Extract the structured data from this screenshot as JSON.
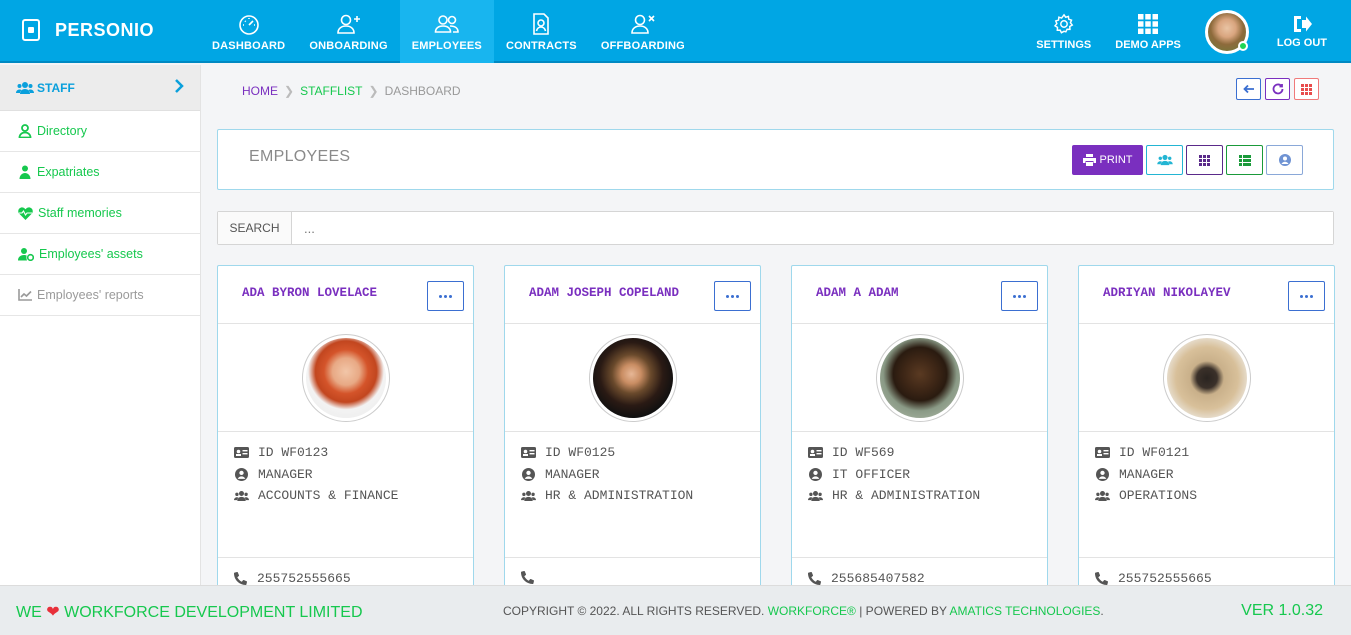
{
  "brand": {
    "name": "PERSONIO"
  },
  "nav": {
    "items": [
      {
        "label": "DASHBOARD"
      },
      {
        "label": "ONBOARDING"
      },
      {
        "label": "EMPLOYEES"
      },
      {
        "label": "CONTRACTS"
      },
      {
        "label": "OFFBOARDING"
      }
    ],
    "active": "EMPLOYEES"
  },
  "right_nav": {
    "settings": "SETTINGS",
    "demo_apps": "DEMO APPS",
    "logout": "LOG OUT"
  },
  "sidebar": {
    "header": "STAFF",
    "items": [
      {
        "label": "Directory",
        "icon": "user-tie-icon"
      },
      {
        "label": "Expatriates",
        "icon": "expat-icon"
      },
      {
        "label": "Staff memories",
        "icon": "heartbeat-icon"
      },
      {
        "label": "Employees' assets",
        "icon": "user-cog-icon"
      },
      {
        "label": "Employees' reports",
        "icon": "chart-line-icon"
      }
    ]
  },
  "breadcrumb": {
    "home": "HOME",
    "stafflist": "STAFFLIST",
    "current": "DASHBOARD"
  },
  "panel": {
    "title": "EMPLOYEES",
    "print": "PRINT"
  },
  "search": {
    "label": "SEARCH",
    "placeholder": "..."
  },
  "employees": [
    {
      "name": "ADA BYRON LOVELACE",
      "id": "ID WF0123",
      "role": "MANAGER",
      "department": "ACCOUNTS & FINANCE",
      "phone": "255752555665"
    },
    {
      "name": "ADAM JOSEPH COPELAND",
      "id": "ID WF0125",
      "role": "MANAGER",
      "department": "HR & ADMINISTRATION",
      "phone": ""
    },
    {
      "name": "ADAM A ADAM",
      "id": "ID WF569",
      "role": "IT OFFICER",
      "department": "HR & ADMINISTRATION",
      "phone": "255685407582"
    },
    {
      "name": "ADRIYAN NIKOLAYEV",
      "id": "ID WF0121",
      "role": "MANAGER",
      "department": "OPERATIONS",
      "phone": "255752555665"
    }
  ],
  "footer": {
    "left_prefix": "WE",
    "left_suffix": "WORKFORCE DEVELOPMENT LIMITED",
    "copyright": "COPYRIGHT © 2022. ALL RIGHTS RESERVED.",
    "workforce": "WORKFORCE®",
    "powered": "| POWERED BY",
    "amatics": "AMATICS TECHNOLOGIES",
    "period": ".",
    "version": "VER 1.0.32"
  },
  "colors": {
    "topbar": "#00a6e4",
    "accent_purple": "#7a2fbf",
    "accent_green": "#16c84e",
    "card_border": "#9fd8ec"
  }
}
